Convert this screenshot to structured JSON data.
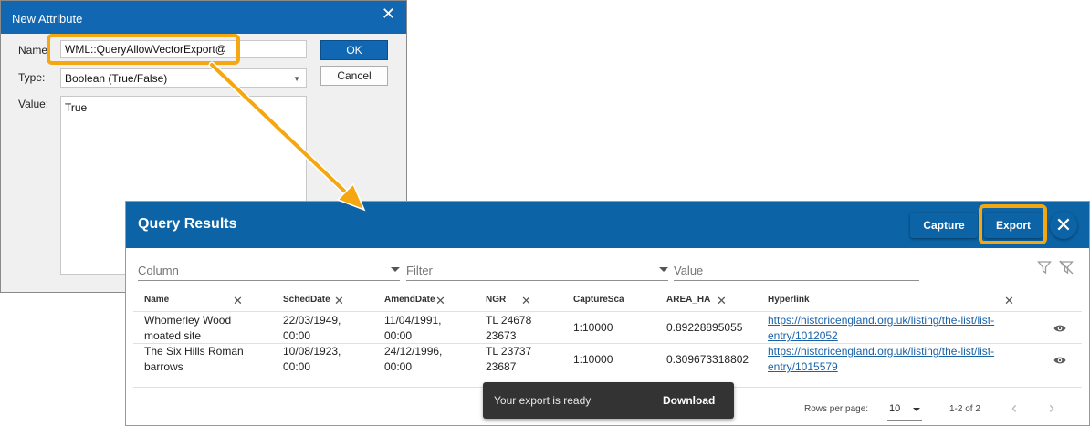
{
  "dialog": {
    "title": "New Attribute",
    "close_glyph": "✕",
    "name_label": "Name:",
    "name_value": "WML::QueryAllowVectorExport@",
    "type_label": "Type:",
    "type_value": "Boolean (True/False)",
    "value_label": "Value:",
    "value_text": "True",
    "ok_label": "OK",
    "cancel_label": "Cancel"
  },
  "query_results": {
    "title": "Query Results",
    "capture_label": "Capture",
    "export_label": "Export",
    "close_glyph": "✕",
    "filter": {
      "column_placeholder": "Column",
      "filter_placeholder": "Filter",
      "value_placeholder": "Value"
    },
    "columns": [
      "Name",
      "SchedDate",
      "AmendDate",
      "NGR",
      "CaptureSca",
      "AREA_HA",
      "Hyperlink"
    ],
    "remove_glyph": "✕",
    "rows": [
      {
        "name_l1": "Whomerley Wood",
        "name_l2": "moated site",
        "sched_l1": "22/03/1949,",
        "sched_l2": "00:00",
        "amend_l1": "11/04/1991,",
        "amend_l2": "00:00",
        "ngr_l1": "TL 24678",
        "ngr_l2": "23673",
        "capture": "1:10000",
        "area": "0.89228895055",
        "link_l1": "https://historicengland.org.uk/listing/the-list/list-",
        "link_l2": "entry/1012052"
      },
      {
        "name_l1": "The Six Hills Roman",
        "name_l2": "barrows",
        "sched_l1": "10/08/1923,",
        "sched_l2": "00:00",
        "amend_l1": "24/12/1996,",
        "amend_l2": "00:00",
        "ngr_l1": "TL 23737",
        "ngr_l2": "23687",
        "capture": "1:10000",
        "area": "0.309673318802",
        "link_l1": "https://historicengland.org.uk/listing/the-list/list-",
        "link_l2": "entry/1015579"
      }
    ],
    "snackbar": {
      "message": "Your export is ready",
      "action": "Download"
    },
    "pagination": {
      "rows_per_page_label": "Rows per page:",
      "rows_per_page_value": "10",
      "range": "1-2 of 2",
      "prev_glyph": "‹",
      "next_glyph": "›"
    }
  },
  "colors": {
    "accent_blue": "#0c64a6",
    "highlight_orange": "#f5a712",
    "link_blue": "#1a62a8",
    "snackbar_bg": "#333333"
  },
  "icons": [
    "close-icon",
    "dropdown-caret-icon",
    "filter-icon",
    "clear-filter-icon",
    "remove-column-icon",
    "eye-icon",
    "chevron-left-icon",
    "chevron-right-icon",
    "callout-arrow"
  ]
}
